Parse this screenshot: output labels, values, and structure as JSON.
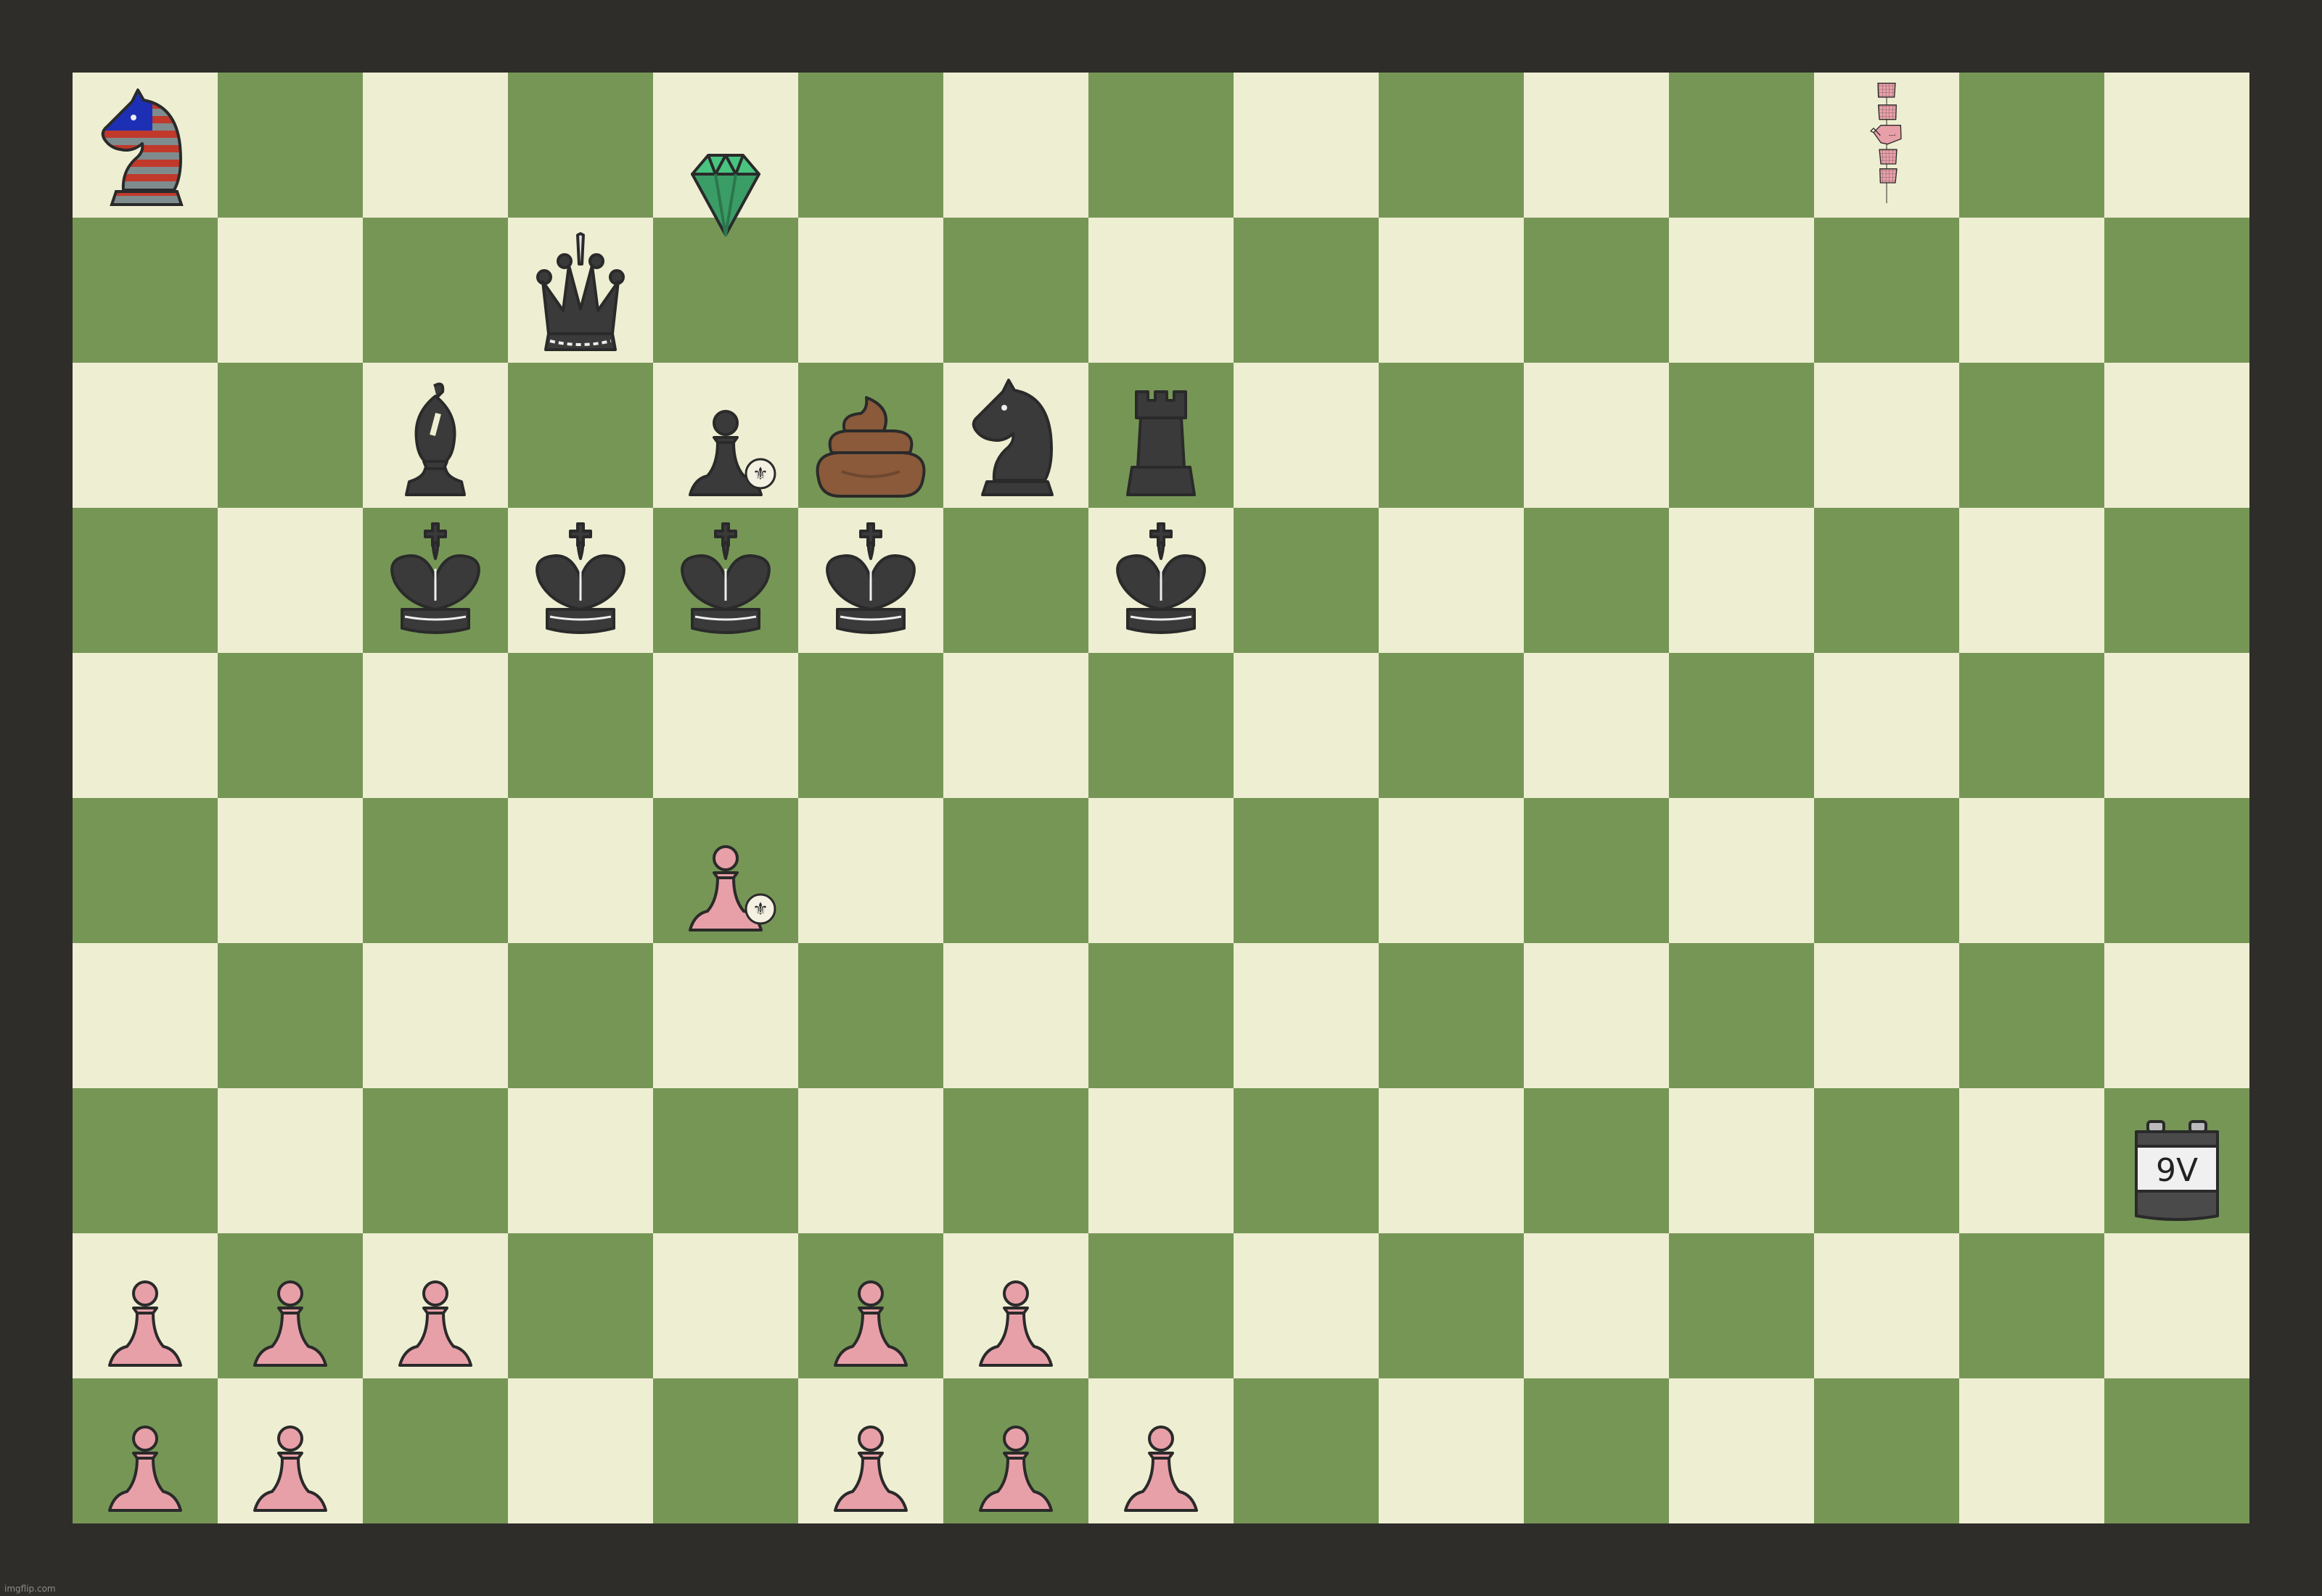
{
  "board": {
    "columns": 15,
    "rows": 10,
    "colors": {
      "light": "#eeeed2",
      "dark": "#769656",
      "frame": "#2e2d2a"
    },
    "pieces": [
      {
        "row": 0,
        "col": 0,
        "kind": "knight",
        "color": "usa-flag",
        "name": "usa-flag-knight-icon"
      },
      {
        "row": 0,
        "col": 4,
        "kind": "gem",
        "color": "#3a9d66",
        "name": "emerald-gem-icon",
        "spill": "down"
      },
      {
        "row": 0,
        "col": 12,
        "kind": "satellite",
        "color": "#e8a0a8",
        "name": "satellite-icon",
        "span": 3
      },
      {
        "row": 1,
        "col": 3,
        "kind": "queen",
        "color": "#3a3a3a",
        "name": "black-queen-icon",
        "spill": "down"
      },
      {
        "row": 2,
        "col": 2,
        "kind": "bishop",
        "color": "#3a3a3a",
        "name": "black-bishop-icon"
      },
      {
        "row": 2,
        "col": 4,
        "kind": "pawn",
        "color": "#3a3a3a",
        "name": "black-pawn-fleur-icon",
        "badge": "⚜"
      },
      {
        "row": 2,
        "col": 5,
        "kind": "poop",
        "color": "#8a5a3a",
        "name": "poop-icon"
      },
      {
        "row": 2,
        "col": 6,
        "kind": "knight",
        "color": "#3a3a3a",
        "name": "black-knight-icon"
      },
      {
        "row": 2,
        "col": 7,
        "kind": "rook",
        "color": "#3a3a3a",
        "name": "black-rook-icon"
      },
      {
        "row": 3,
        "col": 2,
        "kind": "king",
        "color": "#3a3a3a",
        "name": "black-king-icon"
      },
      {
        "row": 3,
        "col": 3,
        "kind": "king",
        "color": "#3a3a3a",
        "name": "black-king-icon"
      },
      {
        "row": 3,
        "col": 4,
        "kind": "king",
        "color": "#3a3a3a",
        "name": "black-king-icon"
      },
      {
        "row": 3,
        "col": 5,
        "kind": "king",
        "color": "#3a3a3a",
        "name": "black-king-icon"
      },
      {
        "row": 3,
        "col": 7,
        "kind": "king",
        "color": "#3a3a3a",
        "name": "black-king-icon"
      },
      {
        "row": 5,
        "col": 4,
        "kind": "pawn",
        "color": "#e8a0a8",
        "name": "pink-pawn-fleur-icon",
        "badge": "⚜"
      },
      {
        "row": 7,
        "col": 14,
        "kind": "battery",
        "color": "#4a4a4a",
        "name": "battery-9v-icon",
        "label": "9V"
      },
      {
        "row": 8,
        "col": 0,
        "kind": "pawn",
        "color": "#e8a0a8",
        "name": "pink-pawn-icon"
      },
      {
        "row": 8,
        "col": 1,
        "kind": "pawn",
        "color": "#e8a0a8",
        "name": "pink-pawn-icon"
      },
      {
        "row": 8,
        "col": 2,
        "kind": "pawn",
        "color": "#e8a0a8",
        "name": "pink-pawn-icon"
      },
      {
        "row": 8,
        "col": 5,
        "kind": "pawn",
        "color": "#e8a0a8",
        "name": "pink-pawn-icon"
      },
      {
        "row": 8,
        "col": 6,
        "kind": "pawn",
        "color": "#e8a0a8",
        "name": "pink-pawn-icon"
      },
      {
        "row": 9,
        "col": 0,
        "kind": "pawn",
        "color": "#e8a0a8",
        "name": "pink-pawn-icon"
      },
      {
        "row": 9,
        "col": 1,
        "kind": "pawn",
        "color": "#e8a0a8",
        "name": "pink-pawn-icon"
      },
      {
        "row": 9,
        "col": 5,
        "kind": "pawn",
        "color": "#e8a0a8",
        "name": "pink-pawn-icon"
      },
      {
        "row": 9,
        "col": 6,
        "kind": "pawn",
        "color": "#e8a0a8",
        "name": "pink-pawn-icon"
      },
      {
        "row": 9,
        "col": 7,
        "kind": "pawn",
        "color": "#e8a0a8",
        "name": "pink-pawn-icon"
      }
    ]
  },
  "watermark": "imgflip.com"
}
